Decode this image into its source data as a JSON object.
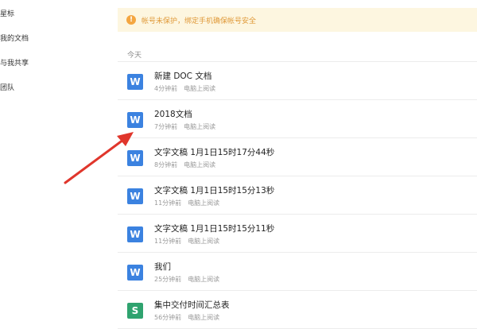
{
  "sidebar": {
    "items": [
      {
        "label": "星标"
      },
      {
        "label": "我的文档"
      },
      {
        "label": "与我共享"
      },
      {
        "label": "团队"
      }
    ]
  },
  "notice": {
    "text": "帐号未保护，绑定手机确保帐号安全"
  },
  "section_label": "今天",
  "files": [
    {
      "name": "新建 DOC 文档",
      "time": "4分钟前",
      "device": "电脑上阅读",
      "icon": "word-icon",
      "glyph": "W"
    },
    {
      "name": "2018文档",
      "time": "7分钟前",
      "device": "电脑上阅读",
      "icon": "word-icon",
      "glyph": "W"
    },
    {
      "name": "文字文稿 1月1日15时17分44秒",
      "time": "8分钟前",
      "device": "电脑上阅读",
      "icon": "word-icon",
      "glyph": "W"
    },
    {
      "name": "文字文稿 1月1日15时15分13秒",
      "time": "11分钟前",
      "device": "电脑上阅读",
      "icon": "word-icon",
      "glyph": "W"
    },
    {
      "name": "文字文稿 1月1日15时15分11秒",
      "time": "11分钟前",
      "device": "电脑上阅读",
      "icon": "word-icon",
      "glyph": "W"
    },
    {
      "name": "我们",
      "time": "25分钟前",
      "device": "电脑上阅读",
      "icon": "word-icon",
      "glyph": "W"
    },
    {
      "name": "集中交付时间汇总表",
      "time": "56分钟前",
      "device": "电脑上阅读",
      "icon": "spreadsheet-icon",
      "glyph": "S"
    }
  ],
  "colors": {
    "word": "#3b82e0",
    "sheet": "#2fa36f",
    "notice_bg": "#fdf6e0",
    "notice_text": "#e09a3a",
    "arrow": "#e0362c"
  }
}
